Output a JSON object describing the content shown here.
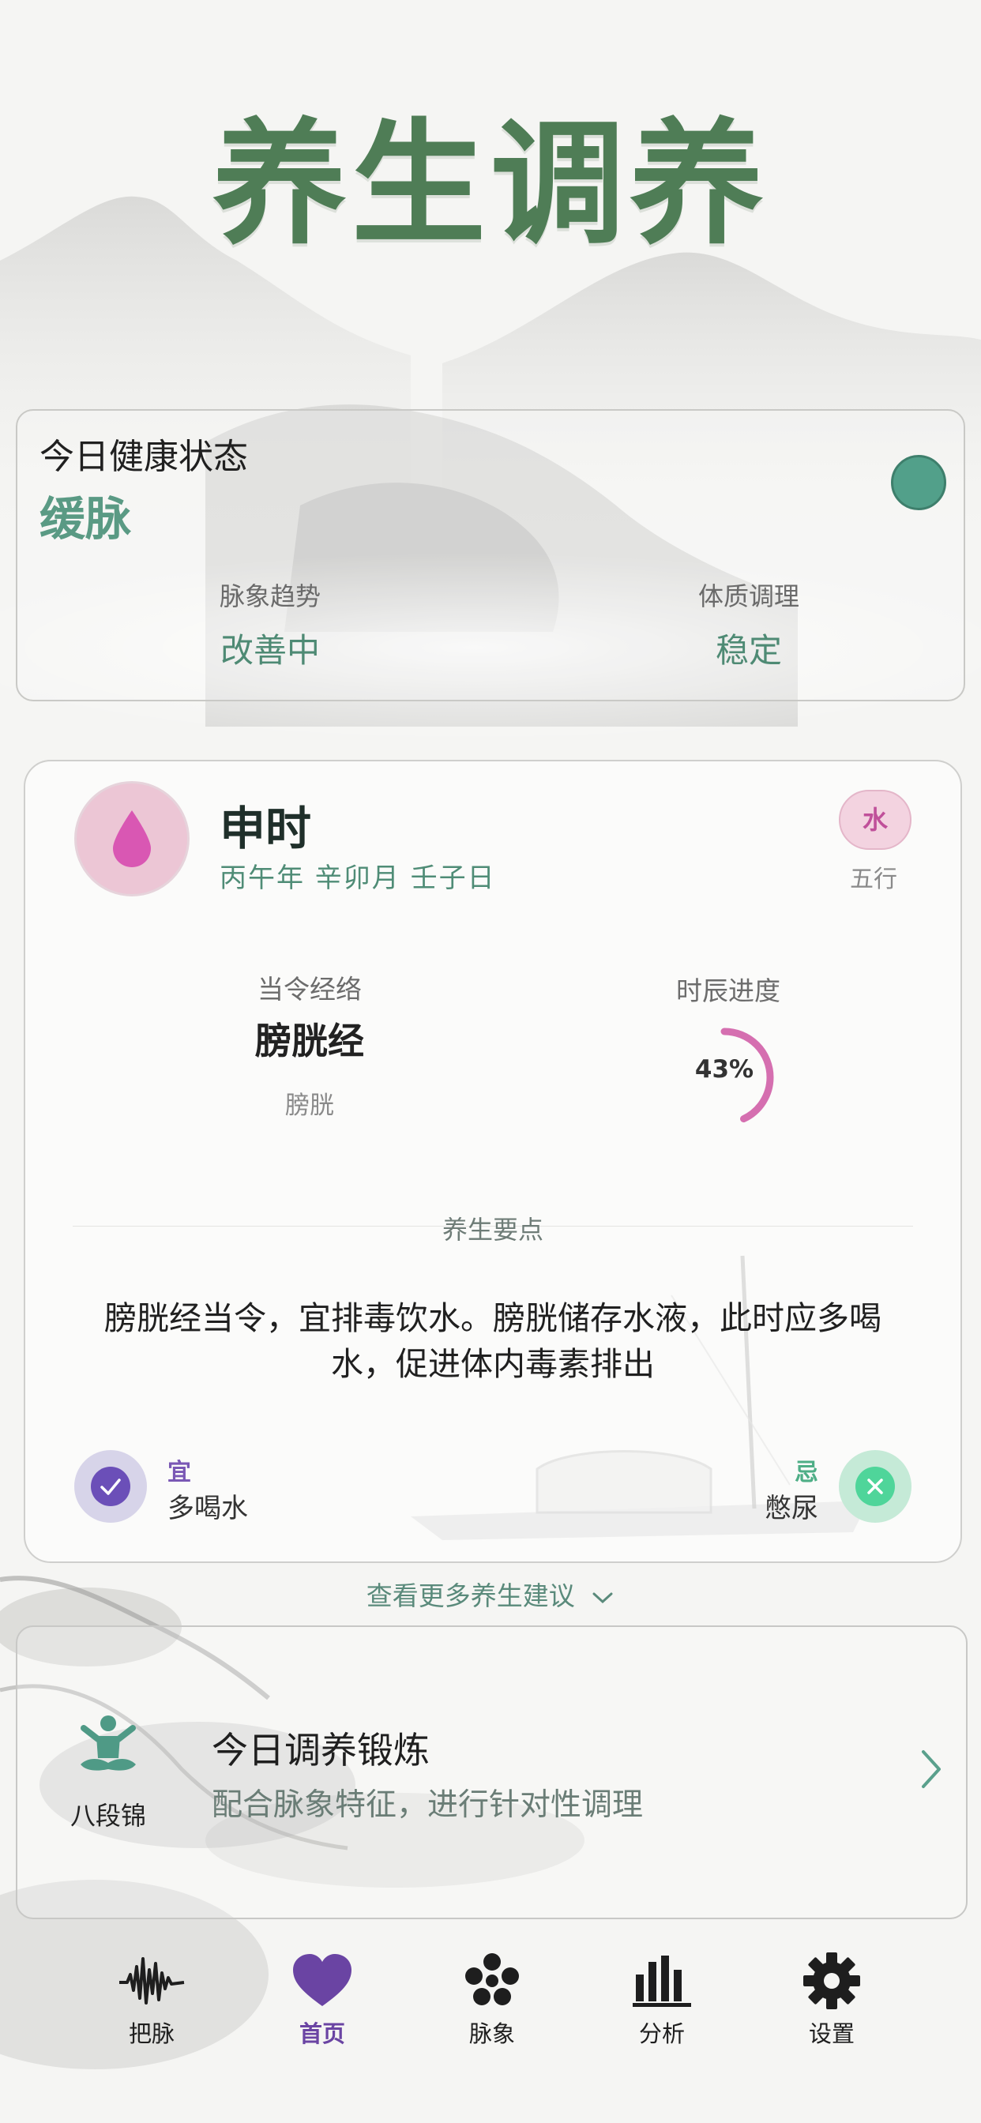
{
  "app": {
    "title": "养生调养"
  },
  "health_status": {
    "title": "今日健康状态",
    "value": "缓脉",
    "indicator_color": "#52a08a",
    "stats": [
      {
        "label": "脉象趋势",
        "value": "改善中"
      },
      {
        "label": "体质调理",
        "value": "稳定"
      }
    ]
  },
  "shichen": {
    "name": "申时",
    "ganzhi": "丙午年 辛卯月 壬子日",
    "wuxing_value": "水",
    "wuxing_label": "五行",
    "icon": "water-drop-icon",
    "meridian": {
      "label": "当令经络",
      "name": "膀胱经",
      "organ": "膀胱"
    },
    "progress": {
      "label": "时辰进度",
      "percent": 43,
      "percent_text": "43%"
    },
    "tips_title": "养生要点",
    "tips_body": "膀胱经当令，宜排毒饮水。膀胱储存水液，此时应多喝水，促进体内毒素排出",
    "yi": {
      "label": "宜",
      "value": "多喝水"
    },
    "ji": {
      "label": "忌",
      "value": "憋尿"
    }
  },
  "more_link": "查看更多养生建议",
  "exercise": {
    "icon_name": "八段锦",
    "title": "今日调养锻炼",
    "subtitle": "配合脉象特征，进行针对性调理"
  },
  "tabbar": {
    "active": "首页",
    "items": [
      {
        "label": "把脉",
        "icon": "pulse-wave-icon"
      },
      {
        "label": "首页",
        "icon": "heart-icon"
      },
      {
        "label": "脉象",
        "icon": "dots-cluster-icon"
      },
      {
        "label": "分析",
        "icon": "bar-chart-icon"
      },
      {
        "label": "设置",
        "icon": "gear-icon"
      }
    ]
  },
  "colors": {
    "brand_green": "#4f7d56",
    "accent_pink": "#c0509a",
    "accent_purple": "#6a44a3",
    "accent_teal": "#52a08a"
  }
}
